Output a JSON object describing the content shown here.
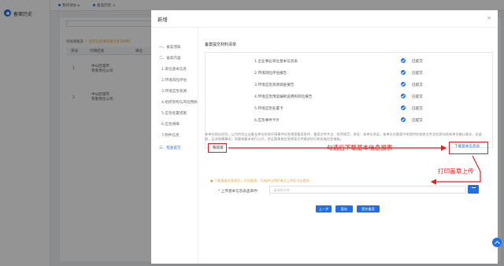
{
  "app": {
    "title": "备案历史"
  },
  "topbar": {
    "tabs": [
      "我的待办 ▸",
      "备案历史 ×"
    ]
  },
  "background": {
    "tip_label": "待处理备案",
    "tip_warn": "⚠ 提示信息请先填写补充材料",
    "table_headers": [
      "序号",
      "行政区划",
      "单位"
    ],
    "rows": [
      {
        "index": "1",
        "unit": "中山区城市\n有限责任公司"
      },
      {
        "index": "2",
        "unit": "中山区城市\n有限责任公司"
      }
    ]
  },
  "modal": {
    "title": "新增",
    "close": "×",
    "steps": [
      {
        "label": "一、备案须知",
        "sub": false,
        "active": false
      },
      {
        "label": "二、备案内容",
        "sub": false,
        "active": false
      },
      {
        "label": "1.单位基本信息",
        "sub": true,
        "active": false
      },
      {
        "label": "2.环境风险评估",
        "sub": true,
        "active": false
      },
      {
        "label": "3.环境应急资源",
        "sub": true,
        "active": false
      },
      {
        "label": "4.组织架构与风险预防",
        "sub": true,
        "active": false
      },
      {
        "label": "5.应急处置措施",
        "sub": true,
        "active": false
      },
      {
        "label": "6.应急保障",
        "sub": true,
        "active": false
      },
      {
        "label": "7.附件信息",
        "sub": true,
        "active": false
      },
      {
        "label": "三、检查提交",
        "sub": false,
        "active": true
      }
    ],
    "section_title": "备案提交材料清单",
    "documents": [
      {
        "name": "1.企业事业单位基本信息表",
        "status": "已提交"
      },
      {
        "name": "2.环境风险评估报告",
        "status": "已提交"
      },
      {
        "name": "3.环境应急资源调查报告",
        "status": "已提交"
      },
      {
        "name": "4.环境应急预案编制说明和风险报告",
        "status": "已提交"
      },
      {
        "name": "5.环境应急处置卡",
        "status": "已提交"
      },
      {
        "name": "6.应急事件卡片",
        "status": "已提交"
      }
    ],
    "notice": "本单位经自评估，认为符合企业事业单位突发环境事件应急预案备案条件，备案文件齐全、程序规范，承诺：本单位承诺，本单位在备案中所提供的相关文件及信息均经本单位确认真实、无虚假，且未隐瞒事实；同意按要求进行公开，并且愿意按应急预案文件要求执行和实施应急措施。",
    "agree_label": "我同意",
    "download_label": "下载基本信息表",
    "annot_download": "勾选后下载基本信息报表",
    "annot_upload": "打印盖章上传",
    "upload_note": "● 下载基本信息表后，打印盖章，扫描件以PDF格式上传后点击提交",
    "upload_label": "* 上传基本信息表盖章件：",
    "upload_placeholder": "请选择文件",
    "footer_buttons": [
      "上一步",
      "暂存",
      "提交备案"
    ]
  }
}
